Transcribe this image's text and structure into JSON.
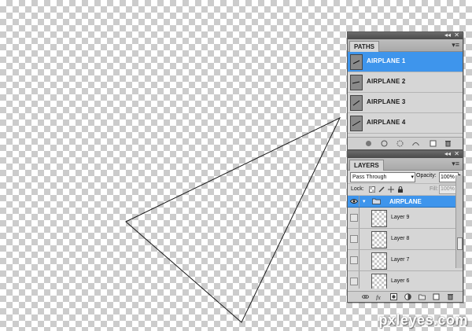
{
  "paths_panel": {
    "tab_label": "PATHS",
    "items": [
      {
        "label": "AIRPLANE 1",
        "selected": true
      },
      {
        "label": "AIRPLANE 2",
        "selected": false
      },
      {
        "label": "AIRPLANE 3",
        "selected": false
      },
      {
        "label": "AIRPLANE 4",
        "selected": false
      }
    ],
    "footer_icons": [
      "fill-path-icon",
      "stroke-path-icon",
      "load-selection-icon",
      "make-work-path-icon",
      "new-path-icon",
      "delete-path-icon"
    ]
  },
  "layers_panel": {
    "tab_label": "LAYERS",
    "blend_mode": "Pass Through",
    "opacity_label": "Opacity:",
    "opacity_value": "100%",
    "lock_label": "Lock:",
    "fill_label": "Fill:",
    "fill_value": "100%",
    "group": {
      "label": "AIRPLANE"
    },
    "layers": [
      {
        "label": "Layer 9"
      },
      {
        "label": "Layer 8"
      },
      {
        "label": "Layer 7"
      },
      {
        "label": "Layer 6"
      }
    ],
    "footer_icons": [
      "link-icon",
      "fx-icon",
      "mask-icon",
      "adjustment-icon",
      "folder-icon",
      "new-layer-icon",
      "trash-icon"
    ]
  },
  "watermark": "pxleyes.com",
  "colors": {
    "selection_blue": "#3e95ec",
    "panel_gray": "#d6d6d6"
  }
}
